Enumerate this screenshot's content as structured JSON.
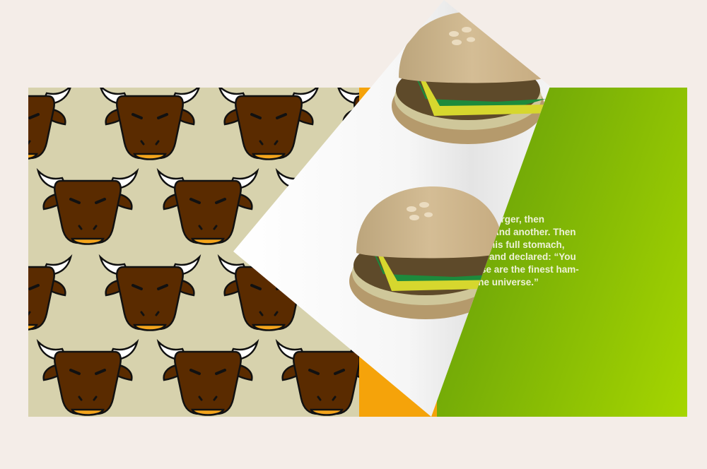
{
  "book": {
    "left_page": {
      "pattern": "bull-head",
      "background": "#d7d2ad"
    },
    "right_page": {
      "text": "ff his burger, then\nother. And another. Then\natted his full stomach,\nhand and declared: “You\n These are the finest ham-\nin the universe.”",
      "gradient": [
        "#5d9808",
        "#a6d600"
      ],
      "accent_orange": "#f5a30a"
    },
    "turning_page": {
      "illustration": "burger-icon",
      "count": 2
    }
  },
  "colors": {
    "bull_body": "#5a2b00",
    "bull_horn": "#ffffff",
    "bull_nose": "#f3a41c",
    "bun": "#c9ad7f",
    "lettuce": "#1d8a3c",
    "cheese": "#d6d72e"
  }
}
